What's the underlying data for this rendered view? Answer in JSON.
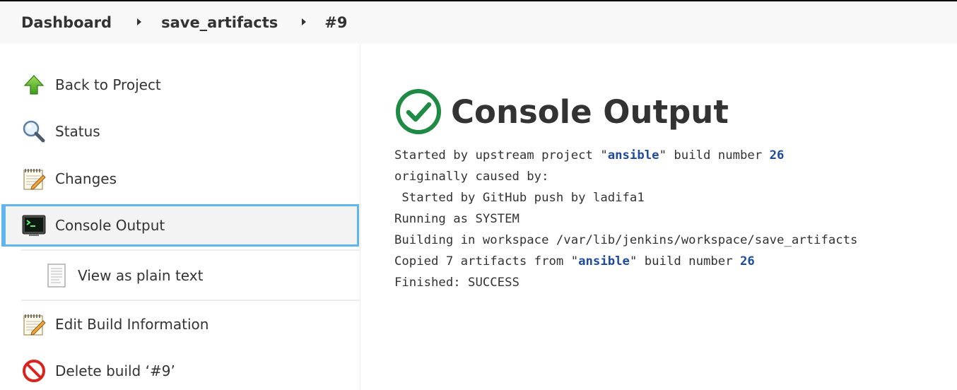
{
  "breadcrumb": {
    "items": [
      {
        "label": "Dashboard"
      },
      {
        "label": "save_artifacts"
      },
      {
        "label": "#9"
      }
    ]
  },
  "sidebar": {
    "items": [
      {
        "label": "Back to Project",
        "icon": "up-arrow-icon"
      },
      {
        "label": "Status",
        "icon": "magnifier-icon"
      },
      {
        "label": "Changes",
        "icon": "notepad-icon"
      },
      {
        "label": "Console Output",
        "icon": "terminal-icon",
        "active": true
      },
      {
        "label": "View as plain text",
        "icon": "document-icon"
      },
      {
        "label": "Edit Build Information",
        "icon": "notepad-icon"
      },
      {
        "label": "Delete build ‘#9’",
        "icon": "no-entry-icon"
      }
    ]
  },
  "main": {
    "title": "Console Output",
    "status_icon": "success-check-icon",
    "console": {
      "line1_pre": "Started by upstream project \"",
      "line1_link": "ansible",
      "line1_mid": "\" build number ",
      "line1_num": "26",
      "line2": "originally caused by:",
      "line3": " Started by GitHub push by ladifa1",
      "line4": "Running as SYSTEM",
      "line5": "Building in workspace /var/lib/jenkins/workspace/save_artifacts",
      "line6_pre": "Copied 7 artifacts from \"",
      "line6_link": "ansible",
      "line6_mid": "\" build number ",
      "line6_num": "26",
      "line7": "Finished: SUCCESS"
    }
  },
  "colors": {
    "active_border": "#5fb5ee",
    "success_green": "#1e8a44",
    "link_blue": "#1f4b9c"
  }
}
